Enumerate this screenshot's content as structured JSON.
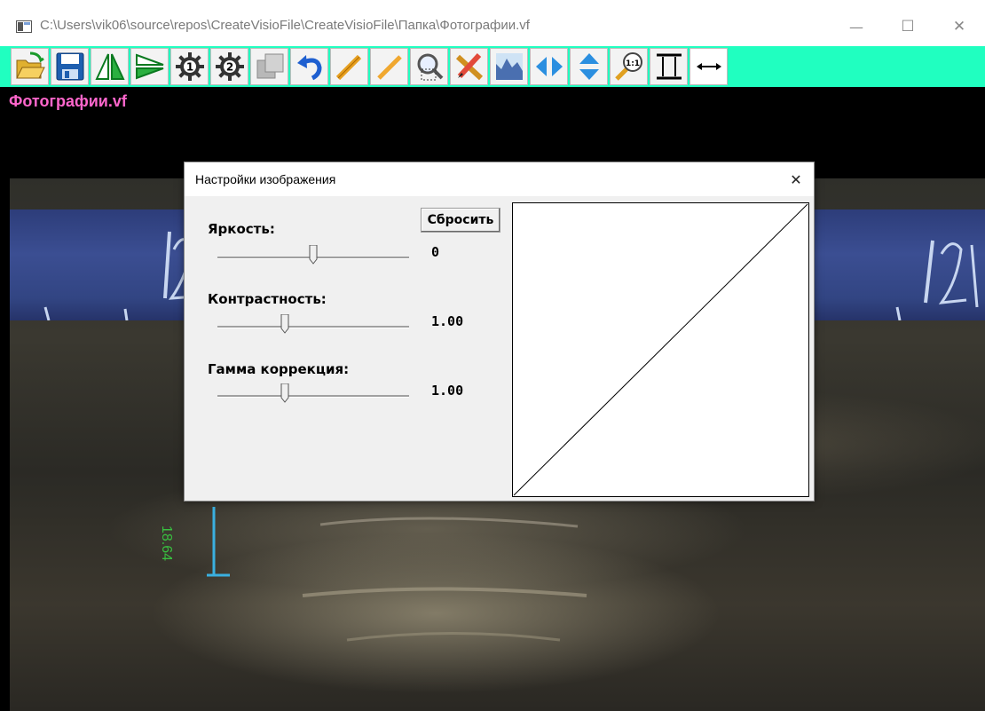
{
  "window": {
    "title": "C:\\Users\\vik06\\source\\repos\\CreateVisioFile\\CreateVisioFile\\Папка\\Фотографии.vf",
    "minimize": "—",
    "maximize": "☐",
    "close": "✕"
  },
  "toolbar": {
    "background": "#20ffc0",
    "buttons": [
      "open-folder",
      "save",
      "flip-horizontal",
      "flip-vertical",
      "settings-1",
      "settings-2",
      "copy",
      "undo",
      "ruler",
      "zoom-area",
      "tools",
      "histogram",
      "stretch-horizontal",
      "stretch-vertical",
      "zoom-1-1",
      "fit-height",
      "fit-width"
    ],
    "zoom_label": "1:1"
  },
  "document": {
    "file_label": "Фотографии.vf",
    "measurement": "18.64"
  },
  "dialog": {
    "title": "Настройки изображения",
    "close": "✕",
    "reset_button": "Сбросить",
    "brightness": {
      "label": "Яркость:",
      "value": "0",
      "level": 0.5
    },
    "contrast": {
      "label": "Контрастность:",
      "value": "1.00",
      "level": 0.35
    },
    "gamma": {
      "label": "Гамма коррекция:",
      "value": "1.00",
      "level": 0.35
    }
  }
}
